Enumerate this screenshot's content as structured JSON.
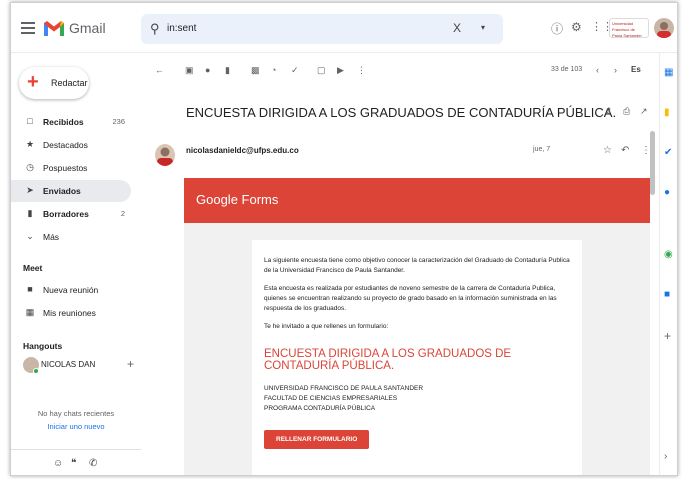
{
  "app": {
    "logo_text": "Gmail",
    "colors": {
      "accent": "#db4437",
      "active_bg": "#e8eaed",
      "search_bg": "#eaf1fb",
      "link": "#1a73e8"
    }
  },
  "search": {
    "value": "in:sent",
    "clear": "X",
    "options": "▾"
  },
  "header_icons": [
    "help-icon",
    "settings-icon",
    "apps-icon"
  ],
  "account": {
    "logo_text": "Universidad Francisco de Paula Santander"
  },
  "compose": {
    "label": "Redactar"
  },
  "nav": [
    {
      "label": "Recibidos",
      "count": "236",
      "bold": true,
      "icon": "inbox-icon"
    },
    {
      "label": "Destacados",
      "count": "",
      "bold": false,
      "icon": "star-icon"
    },
    {
      "label": "Pospuestos",
      "count": "",
      "bold": false,
      "icon": "clock-icon"
    },
    {
      "label": "Enviados",
      "count": "",
      "bold": true,
      "icon": "send-icon",
      "active": true
    },
    {
      "label": "Borradores",
      "count": "2",
      "bold": true,
      "icon": "draft-icon"
    },
    {
      "label": "Más",
      "count": "",
      "bold": false,
      "icon": "chevron-down-icon"
    }
  ],
  "meet": {
    "title": "Meet",
    "items": [
      {
        "label": "Nueva reunión",
        "icon": "video-icon"
      },
      {
        "label": "Mis reuniones",
        "icon": "calendar-icon"
      }
    ]
  },
  "hangouts": {
    "title": "Hangouts",
    "user": "NICOLAS DAN",
    "no_chats": "No hay chats recientes",
    "start_new": "Iniciar uno nuevo"
  },
  "pager": {
    "text": "33 de 103",
    "lang": "Es"
  },
  "message": {
    "subject": "ENCUESTA DIRIGIDA A LOS GRADUADOS DE CONTADURÍA PÚBLICA.",
    "sender": "nicolasdanieldc@ufps.edu.co",
    "date": "jue, 7"
  },
  "form": {
    "brand": "Google Forms",
    "para1": "La siguiente encuesta tiene como objetivo conocer la caracterización del Graduado de Contaduría Publica de la Universidad Francisco de Paula Santander.",
    "para2": "Esta encuesta es realizada por estudiantes de noveno semestre de la carrera de Contaduría Publica, quienes se encuentran realizando su proyecto de grado basado en la información suministrada en las respuesta de los graduados.",
    "para3": "Te he invitado a que rellenes un formulario:",
    "title": "ENCUESTA DIRIGIDA A LOS GRADUADOS DE CONTADURÍA PÚBLICA.",
    "org1": "UNIVERSIDAD FRANCISCO DE PAULA SANTANDER",
    "org2": "FACULTAD DE CIENCIAS EMPRESARIALES",
    "org3": "PROGRAMA CONTADURÍA PÚBLICA",
    "button": "RELLENAR FORMULARIO"
  }
}
